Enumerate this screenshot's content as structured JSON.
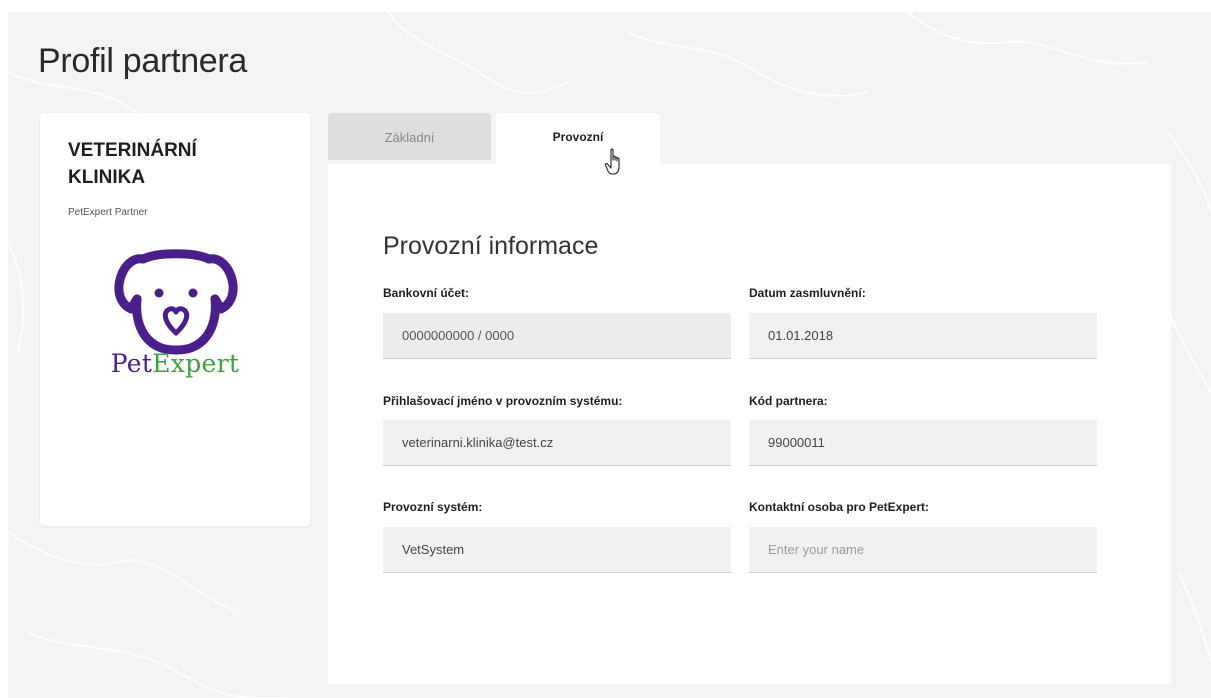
{
  "page": {
    "title": "Profil partnera"
  },
  "partner_card": {
    "name": "VETERINÁRNÍ KLINIKA",
    "subtitle": "PetExpert Partner",
    "logo_text_part1": "Pet",
    "logo_text_part2": "Expert",
    "logo_colors": {
      "primary": "#4a1f8c",
      "secondary": "#3aa53a"
    }
  },
  "tabs": [
    {
      "label": "Základní",
      "active": false
    },
    {
      "label": "Provozní",
      "active": true
    }
  ],
  "section": {
    "title": "Provozní informace",
    "fields": {
      "bank_account": {
        "label": "Bankovní účet:",
        "value": "0000000000 / 0000",
        "disabled": true
      },
      "contract_date": {
        "label": "Datum zasmluvnění:",
        "value": "01.01.2018"
      },
      "login_name": {
        "label": "Přihlašovací jméno v provozním systému:",
        "value": "veterinarni.klinika@test.cz"
      },
      "partner_code": {
        "label": "Kód partnera:",
        "value": "99000011"
      },
      "operating_system": {
        "label": "Provozní systém:",
        "value": "VetSystem"
      },
      "contact_person": {
        "label": "Kontaktní osoba pro PetExpert:",
        "value": "",
        "placeholder": "Enter your name"
      }
    }
  }
}
